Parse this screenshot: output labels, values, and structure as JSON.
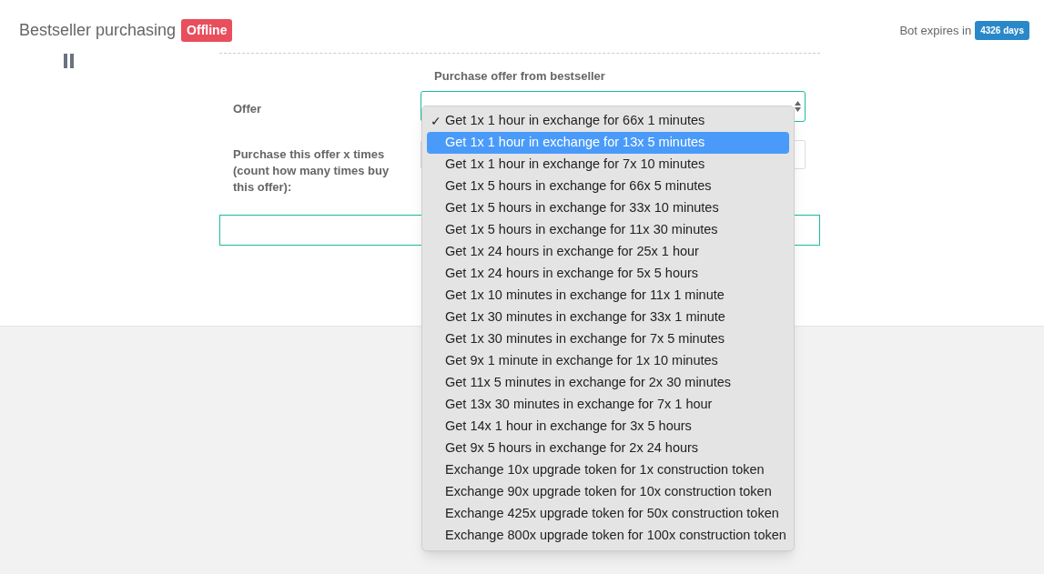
{
  "header": {
    "title": "Bestseller purchasing",
    "status_badge": "Offline",
    "expiry_label": "Bot expires in",
    "expiry_badge": "4326 days"
  },
  "form": {
    "heading": "Purchase offer from bestseller",
    "offer_label": "Offer",
    "times_label": "Purchase this offer x times (count how many times buy this offer):"
  },
  "dropdown": {
    "check_mark": "✓",
    "options": [
      {
        "label": "Get 1x 1 hour in exchange for 66x 1 minutes",
        "checked": true,
        "highlighted": false
      },
      {
        "label": "Get 1x 1 hour in exchange for 13x 5 minutes",
        "checked": false,
        "highlighted": true
      },
      {
        "label": "Get 1x 1 hour in exchange for 7x 10 minutes",
        "checked": false,
        "highlighted": false
      },
      {
        "label": "Get 1x 5 hours in exchange for 66x 5 minutes",
        "checked": false,
        "highlighted": false
      },
      {
        "label": "Get 1x 5 hours in exchange for 33x 10 minutes",
        "checked": false,
        "highlighted": false
      },
      {
        "label": "Get 1x 5 hours in exchange for 11x 30 minutes",
        "checked": false,
        "highlighted": false
      },
      {
        "label": "Get 1x 24 hours in exchange for 25x 1 hour",
        "checked": false,
        "highlighted": false
      },
      {
        "label": "Get 1x 24 hours in exchange for 5x 5 hours",
        "checked": false,
        "highlighted": false
      },
      {
        "label": "Get 1x 10 minutes in exchange for 11x 1 minute",
        "checked": false,
        "highlighted": false
      },
      {
        "label": "Get 1x 30 minutes in exchange for 33x 1 minute",
        "checked": false,
        "highlighted": false
      },
      {
        "label": "Get 1x 30 minutes in exchange for 7x 5 minutes",
        "checked": false,
        "highlighted": false
      },
      {
        "label": "Get 9x 1 minute in exchange for 1x 10 minutes",
        "checked": false,
        "highlighted": false
      },
      {
        "label": "Get 11x 5 minutes in exchange for 2x 30 minutes",
        "checked": false,
        "highlighted": false
      },
      {
        "label": "Get 13x 30 minutes in exchange for 7x 1 hour",
        "checked": false,
        "highlighted": false
      },
      {
        "label": "Get 14x 1 hour in exchange for 3x 5 hours",
        "checked": false,
        "highlighted": false
      },
      {
        "label": "Get 9x 5 hours in exchange for 2x 24 hours",
        "checked": false,
        "highlighted": false
      },
      {
        "label": "Exchange 10x upgrade token for 1x construction token",
        "checked": false,
        "highlighted": false
      },
      {
        "label": "Exchange 90x upgrade token for 10x construction token",
        "checked": false,
        "highlighted": false
      },
      {
        "label": "Exchange 425x upgrade token for 50x construction token",
        "checked": false,
        "highlighted": false
      },
      {
        "label": "Exchange 800x upgrade token for 100x construction token",
        "checked": false,
        "highlighted": false
      }
    ]
  }
}
